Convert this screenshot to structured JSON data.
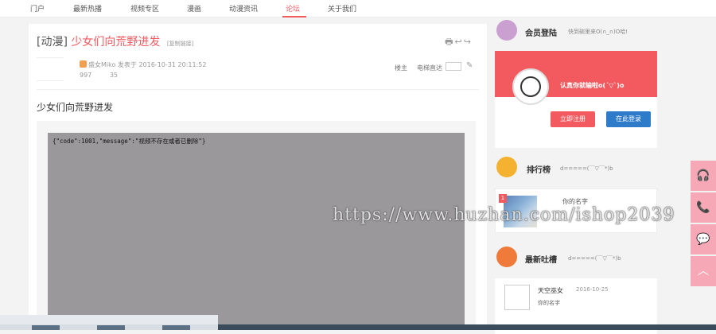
{
  "nav": {
    "items": [
      "门户",
      "最新热播",
      "视频专区",
      "漫画",
      "动漫资讯",
      "论坛",
      "关于我们"
    ],
    "active": "论坛"
  },
  "post": {
    "category": "[动漫]",
    "title": "少女们向荒野进发",
    "tag": "[复制链接]",
    "tools": "🖶↩↪",
    "author_date": "盛女Miko 发表于 2016-10-31 20:11:52",
    "views": "997",
    "replies": "35",
    "owner_label": "楼主",
    "jump_label": "电梯直达",
    "subject": "少女们向荒野进发",
    "player_message": "{\"code\":1001,\"message\":\"视频不存在或者已删除\"}"
  },
  "sidebar": {
    "login": {
      "title": "会员登陆",
      "subtitle": "快到碗里来O(∩_∩)O哈!",
      "slogan": "认真你就输啦o(´▽`)o",
      "register_label": "立即注册",
      "login_label": "在此登录"
    },
    "rank": {
      "title": "排行榜",
      "subtitle": "d=====(￣▽￣*)b",
      "item": {
        "badge": "1",
        "name": "你的名字",
        "meta": ""
      }
    },
    "tucao": {
      "title": "最新吐槽",
      "subtitle": "d=====(￣▽￣*)b",
      "item": {
        "name": "天空巫女",
        "date": "2016-10-25",
        "text": "你的名字"
      }
    }
  },
  "float_buttons": [
    "🎧",
    "📞",
    "💬",
    "︿"
  ],
  "watermark": "https://www.huzhan.com/ishop2039"
}
